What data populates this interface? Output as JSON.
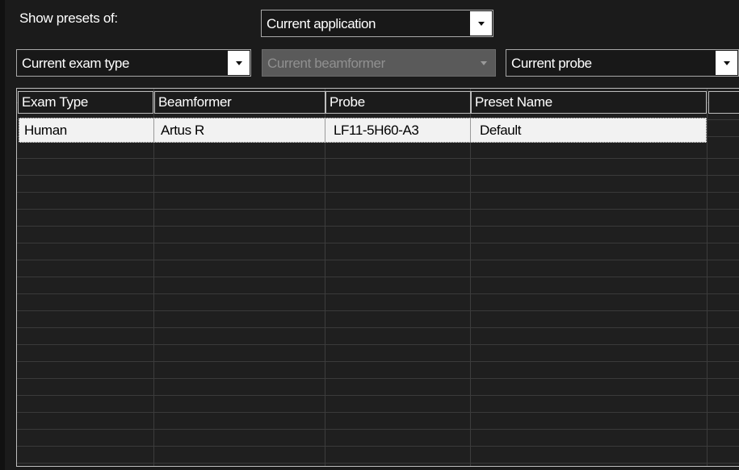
{
  "filter": {
    "label": "Show presets of:",
    "application": "Current application",
    "exam_type": "Current exam type",
    "beamformer": "Current beamformer",
    "probe": "Current probe"
  },
  "table": {
    "columns": [
      "Exam Type",
      "Beamformer",
      "Probe",
      "Preset Name",
      ""
    ],
    "rows": [
      [
        "Human",
        "Artus R",
        "LF11-5H60-A3",
        "Default"
      ]
    ]
  }
}
